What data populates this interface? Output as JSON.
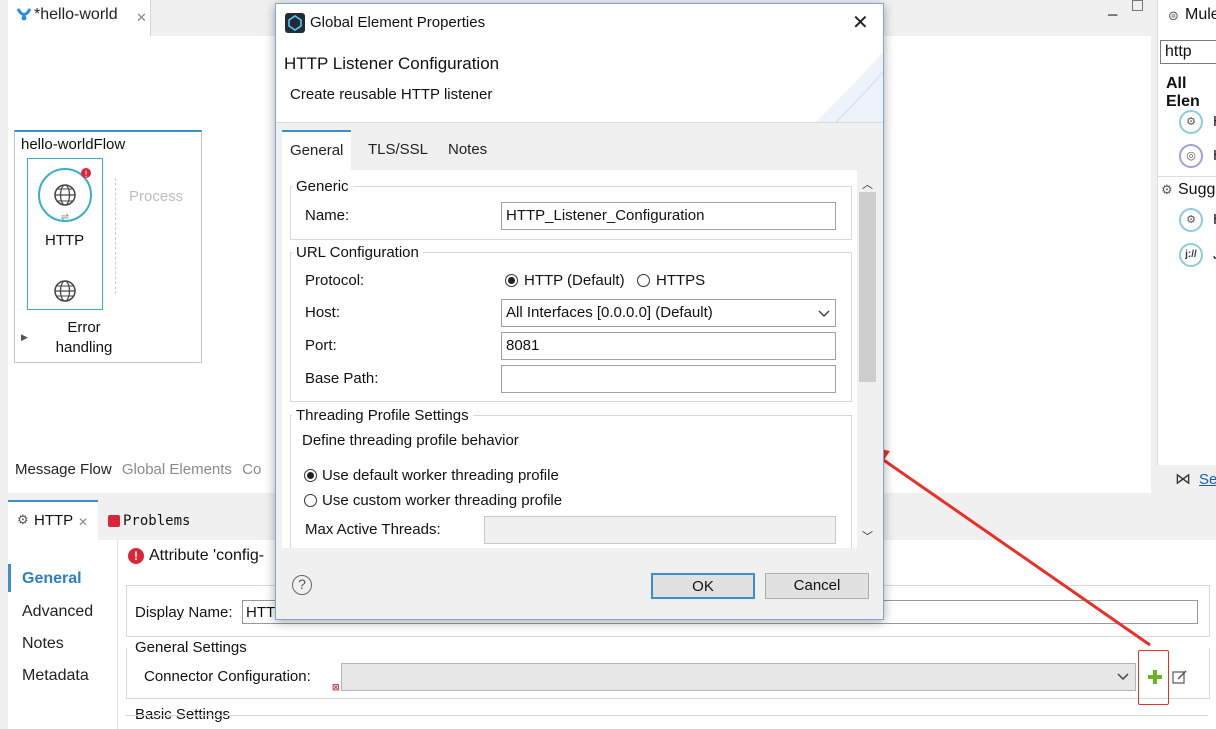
{
  "editor": {
    "tab_title": "*hello-world",
    "flow_name": "hello-worldFlow",
    "source_label": "HTTP",
    "process_label": "Process",
    "error_label_1": "Error",
    "error_label_2": "handling",
    "canvas_tabs": [
      "Message Flow",
      "Global Elements",
      "Co"
    ]
  },
  "palette": {
    "header": "Mule",
    "search_value": "http",
    "all_elements": "All Elen",
    "item_letter": "H",
    "suggested": "Sugg",
    "suggest_letter_1": "H",
    "suggest_letter_2": "J",
    "json_icon_text": "j://",
    "bottom_link": "Se"
  },
  "props": {
    "tab_http": "HTTP",
    "tab_problems": "Problems",
    "nav": [
      "General",
      "Advanced",
      "Notes",
      "Metadata"
    ],
    "error_text": "Attribute 'config-",
    "display_name_label": "Display Name:",
    "display_name_value": "HTT",
    "general_settings": "General Settings",
    "connector_config_label": "Connector Configuration:",
    "basic_settings": "Basic Settings"
  },
  "dialog": {
    "window_title": "Global Element Properties",
    "heading": "HTTP Listener Configuration",
    "subheading": "Create reusable HTTP listener",
    "tabs": [
      "General",
      "TLS/SSL",
      "Notes"
    ],
    "generic_legend": "Generic",
    "name_label": "Name:",
    "name_value": "HTTP_Listener_Configuration",
    "url_legend": "URL Configuration",
    "protocol_label": "Protocol:",
    "protocol_http": "HTTP (Default)",
    "protocol_https": "HTTPS",
    "host_label": "Host:",
    "host_value": "All Interfaces [0.0.0.0] (Default)",
    "port_label": "Port:",
    "port_value": "8081",
    "base_path_label": "Base Path:",
    "base_path_value": "",
    "threading_legend": "Threading Profile Settings",
    "threading_desc": "Define threading profile behavior",
    "default_profile": "Use default worker threading profile",
    "custom_profile": "Use custom worker threading profile",
    "max_threads_label": "Max Active Threads:",
    "ok_label": "OK",
    "cancel_label": "Cancel",
    "help_glyph": "?"
  },
  "colors": {
    "accent": "#3c8ec9",
    "annotation": "#e8302a",
    "add_icon": "#6bb524"
  },
  "icons": [
    "mule-icon",
    "globe-icon",
    "error-badge-icon",
    "close-icon",
    "help-icon",
    "plus-icon",
    "edit-icon",
    "chevron-down-icon"
  ]
}
